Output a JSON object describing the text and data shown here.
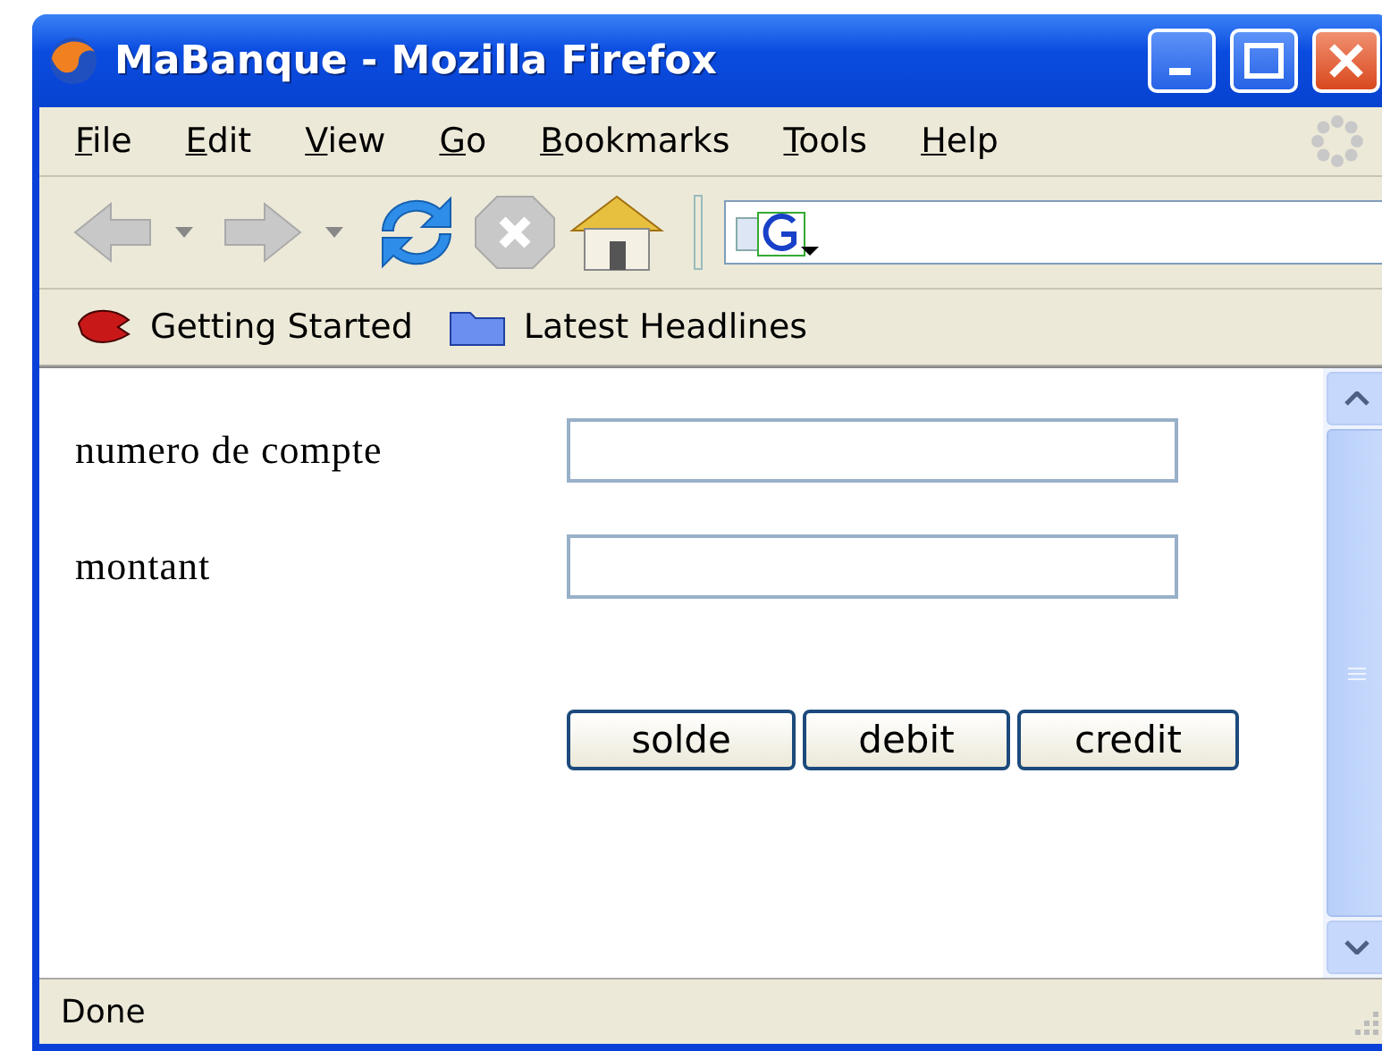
{
  "window": {
    "title": "MaBanque - Mozilla Firefox"
  },
  "menu": [
    {
      "label": "File"
    },
    {
      "label": "Edit"
    },
    {
      "label": "View"
    },
    {
      "label": "Go"
    },
    {
      "label": "Bookmarks"
    },
    {
      "label": "Tools"
    },
    {
      "label": "Help"
    }
  ],
  "toolbar": [
    {
      "kind": "back",
      "disabled": true
    },
    {
      "kind": "forward",
      "disabled": true
    },
    {
      "kind": "reload",
      "disabled": false
    },
    {
      "kind": "stop",
      "disabled": true
    },
    {
      "kind": "home",
      "disabled": false
    }
  ],
  "bookmarks": [
    {
      "kind": "page",
      "label": "Getting Started"
    },
    {
      "kind": "folder",
      "label": "Latest Headlines"
    }
  ],
  "form": {
    "fields": [
      {
        "label": "numero de compte"
      },
      {
        "label": "montant"
      }
    ],
    "buttons": [
      "solde",
      "debit",
      "credit"
    ]
  },
  "status_bar": {
    "text": "Done"
  }
}
